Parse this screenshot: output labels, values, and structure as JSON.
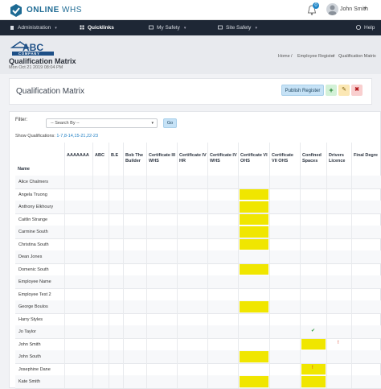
{
  "app": {
    "brand_strong": "ONLINE",
    "brand_light": " WHS",
    "notifications_count": "0",
    "user_name": "John Smith",
    "user_caret": "▾"
  },
  "nav": {
    "items": [
      {
        "label": "Administration",
        "icon": "building-icon"
      },
      {
        "label": "Quicklinks",
        "icon": "quicklinks-icon",
        "active": true
      },
      {
        "label": "My Safety",
        "icon": "safety-icon"
      },
      {
        "label": "Site Safety",
        "icon": "site-icon"
      }
    ],
    "help_label": "Help",
    "caret": "▾"
  },
  "header": {
    "company_logo_text": "ABC",
    "company_logo_sub": "COMPANY",
    "title": "Qualification Matrix",
    "date": "Mon Oct 21 2019 08:04 PM",
    "breadcrumb": [
      "Home",
      "Employee Register",
      "Qualification Matrix"
    ],
    "breadcrumb_sep": "/"
  },
  "panel": {
    "title": "Qualification Matrix",
    "publish_label": "Publish Register",
    "add_label": "+",
    "edit_label": "✎",
    "delete_label": "✖"
  },
  "filter": {
    "label": "Filter:",
    "select_value": "-- Search By --",
    "go_label": "Go",
    "show_label": "Show Qualifications:",
    "show_value": "1-7,8-14,15-21,22-23"
  },
  "table": {
    "columns": [
      "Name",
      "AAAAAAA",
      "ABC",
      "B.E",
      "Bob The Builder",
      "Certificate III WHS",
      "Certificate IV HR",
      "Certificate IV WHS",
      "Certificate VI OHS",
      "Certificate VII OHS",
      "Confined Spaces",
      "Drivers Licence",
      "Final Degre"
    ],
    "rows": [
      {
        "name": "Alice Chalmers",
        "cells": {}
      },
      {
        "name": "Angela Truong",
        "cells": {
          "cert_vi_ohs": "yellow"
        }
      },
      {
        "name": "Anthony Elkhoury",
        "cells": {
          "cert_vi_ohs": "yellow"
        }
      },
      {
        "name": "Caitlin Strange",
        "cells": {
          "cert_vi_ohs": "yellow"
        }
      },
      {
        "name": "Carmine South",
        "cells": {
          "cert_vi_ohs": "yellow"
        }
      },
      {
        "name": "Christina South",
        "cells": {
          "cert_vi_ohs": "yellow"
        }
      },
      {
        "name": "Dean Jones",
        "cells": {}
      },
      {
        "name": "Domenic South",
        "cells": {
          "cert_vi_ohs": "yellow"
        }
      },
      {
        "name": "Employee Name",
        "cells": {}
      },
      {
        "name": "Employee Test 2",
        "cells": {}
      },
      {
        "name": "George Boulos",
        "cells": {
          "cert_vi_ohs": "yellow"
        }
      },
      {
        "name": "Harry Styles",
        "cells": {}
      },
      {
        "name": "Jo Taylor",
        "cells": {
          "confined": "check"
        }
      },
      {
        "name": "John Smith",
        "cells": {
          "confined": "yellow",
          "drivers": "cross"
        }
      },
      {
        "name": "John South",
        "cells": {
          "cert_vi_ohs": "yellow"
        }
      },
      {
        "name": "Josephine Dane",
        "cells": {
          "confined": "yellow-cross"
        }
      },
      {
        "name": "Kate Smith",
        "cells": {
          "cert_vi_ohs": "yellow",
          "confined": "yellow"
        }
      }
    ],
    "check_glyph": "✔",
    "cross_glyph": "ǃ"
  },
  "colors": {
    "nav_bg": "#1e2735",
    "highlight_yellow": "#f0e600",
    "accent_blue": "#1f86c8"
  }
}
